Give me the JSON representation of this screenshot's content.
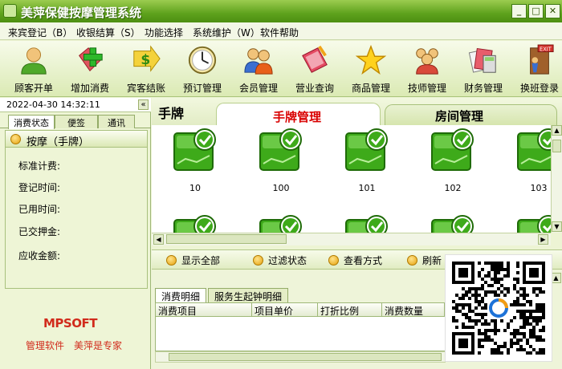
{
  "window": {
    "title": "美萍保健按摩管理系统"
  },
  "menu": [
    {
      "label": "来宾登记（B）"
    },
    {
      "label": "收银结算（S）"
    },
    {
      "label": "功能选择"
    },
    {
      "label": "系统维护（W）"
    },
    {
      "label": "软件帮助"
    }
  ],
  "toolbar": [
    {
      "label": "顾客开单",
      "icon": "customer-icon"
    },
    {
      "label": "增加消费",
      "icon": "add-consumption-icon"
    },
    {
      "label": "宾客结账",
      "icon": "checkout-icon"
    },
    {
      "label": "预订管理",
      "icon": "clock-icon"
    },
    {
      "label": "会员管理",
      "icon": "members-icon"
    },
    {
      "label": "营业查询",
      "icon": "query-icon"
    },
    {
      "label": "商品管理",
      "icon": "star-icon"
    },
    {
      "label": "技师管理",
      "icon": "staff-icon"
    },
    {
      "label": "财务管理",
      "icon": "finance-icon"
    },
    {
      "label": "换班登录",
      "icon": "exit-icon"
    }
  ],
  "left": {
    "datetime": "2022-04-30 14:32:11",
    "collapse": "«",
    "tabs": [
      "消费状态",
      "便签",
      "通讯"
    ],
    "status_title": "按摩（手牌）",
    "fields": [
      "标准计费:",
      "登记时间:",
      "已用时间:",
      "已交押金:",
      "应收金额:"
    ],
    "brand": "MPSOFT",
    "slogan": [
      "管理软件",
      "美萍是专家"
    ]
  },
  "main": {
    "tab_left": "手牌",
    "tab_current": "手牌管理",
    "tab_room": "房间管理",
    "rooms_row1": [
      "10",
      "100",
      "101",
      "102",
      "103"
    ],
    "rooms_row2": [
      "",
      "",
      "",
      "",
      ""
    ]
  },
  "actions": [
    {
      "label": "显示全部"
    },
    {
      "label": "过滤状态"
    },
    {
      "label": "查看方式"
    },
    {
      "label": "刷新"
    }
  ],
  "bottom": {
    "tabs": [
      "消费明细",
      "服务生起钟明细"
    ],
    "columns": [
      "消费项目",
      "项目单价",
      "打折比例",
      "消费数量"
    ]
  },
  "colors": {
    "accent_green": "#5ea21d",
    "brand_red": "#d12b1c",
    "room_green": "#3eaa1a"
  }
}
